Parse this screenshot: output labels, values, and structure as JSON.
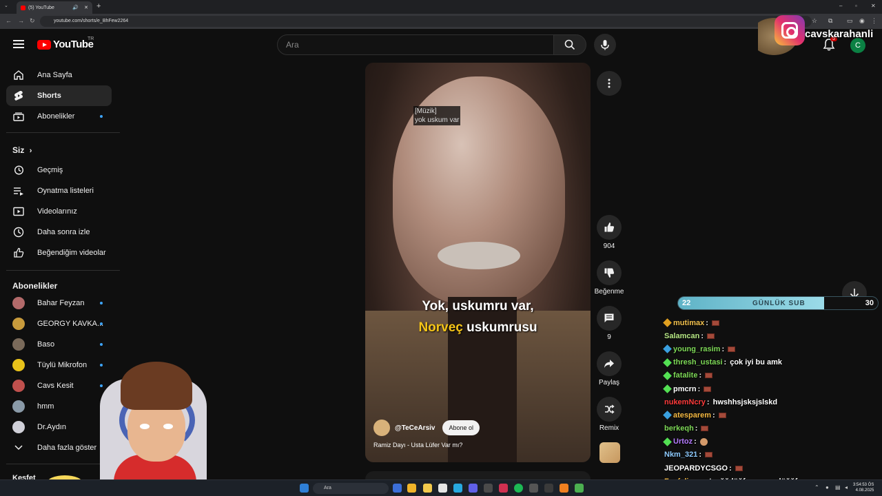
{
  "browser": {
    "tab_title": "(5) YouTube",
    "url": "youtube.com/shorts/e_BhFew2264",
    "new_tab": "+",
    "win_min": "–",
    "win_max": "▫",
    "win_close": "✕"
  },
  "header": {
    "logo_text": "YouTube",
    "region": "TR",
    "search_placeholder": "Ara",
    "notification_count": "5",
    "avatar_letter": "C"
  },
  "sidebar": {
    "main": [
      {
        "label": "Ana Sayfa"
      },
      {
        "label": "Shorts"
      },
      {
        "label": "Abonelikler"
      }
    ],
    "you_title": "Siz",
    "you_items": [
      {
        "label": "Geçmiş"
      },
      {
        "label": "Oynatma listeleri"
      },
      {
        "label": "Videolarınız"
      },
      {
        "label": "Daha sonra izle"
      },
      {
        "label": "Beğendiğim videolar"
      }
    ],
    "subs_title": "Abonelikler",
    "subs": [
      {
        "label": "Bahar Feyzan",
        "color": "#b36a6a"
      },
      {
        "label": "GEORGY KAVKA...",
        "color": "#c89b3c"
      },
      {
        "label": "Baso",
        "color": "#7a6a5a"
      },
      {
        "label": "Tüylü Mikrofon",
        "color": "#e8c21a"
      },
      {
        "label": "Cavs Kesit",
        "color": "#c0504d"
      },
      {
        "label": "hmm",
        "color": "#8a9aa8"
      },
      {
        "label": "Dr.Aydın",
        "color": "#d0d0d8"
      }
    ],
    "show_more": "Daha fazla göster",
    "partial_section": "Keşfet"
  },
  "video": {
    "cc_line1": "[Müzik]",
    "cc_line2": "yok uskum var",
    "sub_line1": "Yok, uskumru var,",
    "sub_line2_yellow": "Norveç",
    "sub_line2_rest": " uskumrusu",
    "channel_name": "@TeCeArsiv",
    "subscribe_label": "Abone ol",
    "title": "Ramiz Dayı - Usta Lüfer Var mı?"
  },
  "actions": {
    "likes": "904",
    "dislike_label": "Beğenme",
    "comments": "9",
    "share_label": "Paylaş",
    "remix_label": "Remix"
  },
  "overlay": {
    "instagram_handle": "cavskarahanli",
    "sub_goal_label": "GÜNLÜK SUB",
    "sub_current": "22",
    "sub_target": "30",
    "sub_progress": 0.73
  },
  "chat": [
    {
      "user": "mutimax",
      "color": "#f2c14e",
      "msg": "",
      "badge": "#e0a020",
      "brick": true,
      "emote": false
    },
    {
      "user": "Salamcan",
      "color": "#b8e986",
      "msg": "",
      "badge": "",
      "brick": true,
      "emote": false
    },
    {
      "user": "young_rasim",
      "color": "#7ed957",
      "msg": "",
      "badge": "#3aa0e0",
      "brick": true,
      "emote": false
    },
    {
      "user": "thresh_ustasi",
      "color": "#7ed957",
      "msg": "çok iyi bu amk",
      "badge": "#53e053",
      "brick": false,
      "emote": false
    },
    {
      "user": "fatalite",
      "color": "#7ed957",
      "msg": "",
      "badge": "#53e053",
      "brick": true,
      "emote": false
    },
    {
      "user": "pmcrn",
      "color": "#ffffff",
      "msg": "",
      "badge": "#53e053",
      "brick": true,
      "emote": false
    },
    {
      "user": "nukemNcry",
      "color": "#ff3b3b",
      "msg": "hwshhsjsksjslskd",
      "badge": "",
      "brick": false,
      "emote": false
    },
    {
      "user": "atesparem",
      "color": "#f5b942",
      "msg": "",
      "badge": "#3aa0e0",
      "brick": true,
      "emote": false
    },
    {
      "user": "berkeqh",
      "color": "#7ed957",
      "msg": "",
      "badge": "",
      "brick": true,
      "emote": false
    },
    {
      "user": "Urtoz",
      "color": "#b57bff",
      "msg": "",
      "badge": "#53e053",
      "brick": false,
      "emote": true
    },
    {
      "user": "Nkm_321",
      "color": "#8ecbff",
      "msg": "",
      "badge": "",
      "brick": true,
      "emote": false
    },
    {
      "user": "JEOPARDYCSGO",
      "color": "#ffffff",
      "msg": "",
      "badge": "",
      "brick": true,
      "emote": false
    },
    {
      "user": "Foxfelix",
      "color": "#f5b942",
      "msg": "ustaağğ lüğfer var mı lüğğfer",
      "badge": "",
      "brick": false,
      "emote": false
    }
  ],
  "taskbar": {
    "search": "Ara",
    "time": "3:54:53 ÖS",
    "date": "4.08.2025"
  }
}
